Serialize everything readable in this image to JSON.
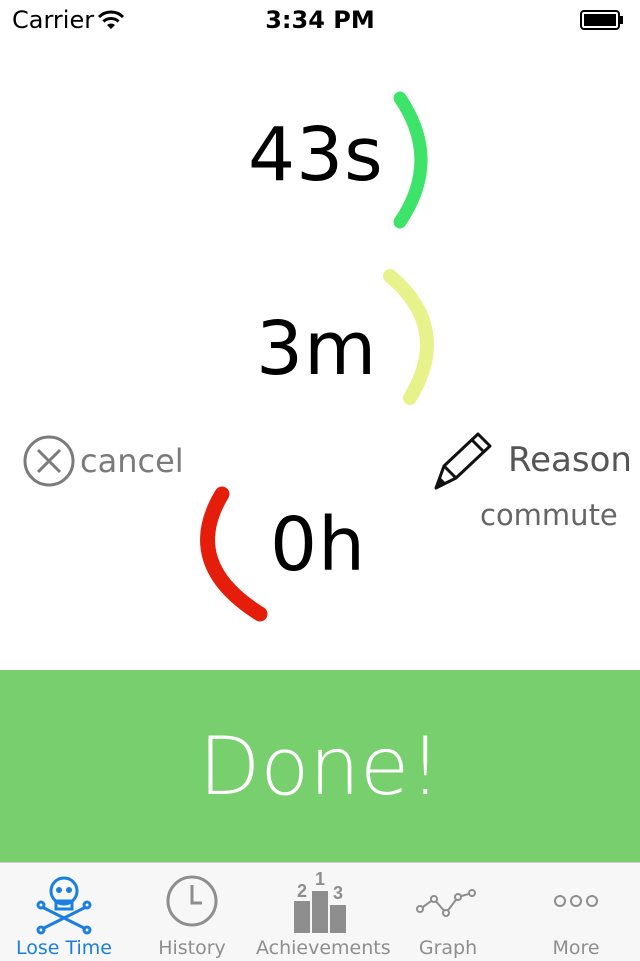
{
  "status_bar": {
    "carrier": "Carrier",
    "time": "3:34 PM"
  },
  "timer": {
    "seconds": "43s",
    "minutes": "3m",
    "hours": "0h"
  },
  "actions": {
    "cancel_label": "cancel",
    "reason_label": "Reason",
    "reason_value": "commute"
  },
  "done_label": "Done!",
  "tabs": [
    {
      "label": "Lose Time",
      "icon": "skull-crossbones-icon",
      "active": true
    },
    {
      "label": "History",
      "icon": "clock-icon",
      "active": false
    },
    {
      "label": "Achievements",
      "icon": "podium-icon",
      "active": false
    },
    {
      "label": "Graph",
      "icon": "line-graph-icon",
      "active": false
    },
    {
      "label": "More",
      "icon": "more-dots-icon",
      "active": false
    }
  ],
  "podium_numbers": [
    "2",
    "1",
    "3"
  ],
  "colors": {
    "seconds_arc": "#3ee36a",
    "minutes_arc": "#e8f28a",
    "hours_arc": "#e41e0b",
    "done_bg": "#77cf6d",
    "active_tab": "#1a7fe0"
  }
}
